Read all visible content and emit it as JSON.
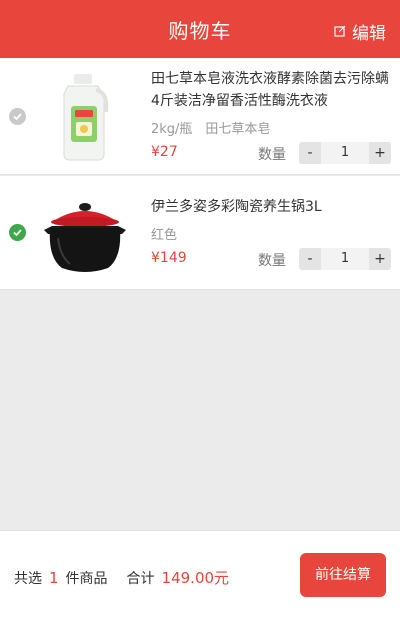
{
  "header": {
    "title": "购物车",
    "edit_label": "编辑"
  },
  "items": [
    {
      "name": "田七草本皂液洗衣液酵素除菌去污除螨4斤装洁净留香活性酶洗衣液",
      "spec": "2kg/瓶　田七草本皂",
      "price": "¥27",
      "qty_label": "数量",
      "qty": "1",
      "selected": false,
      "image": "laundry-detergent-bottle"
    },
    {
      "name": "伊兰多姿多彩陶瓷养生锅3L",
      "spec": "红色",
      "price": "¥149",
      "qty_label": "数量",
      "qty": "1",
      "selected": true,
      "image": "red-ceramic-pot"
    }
  ],
  "stepper": {
    "minus": "-",
    "plus": "+"
  },
  "footer": {
    "selected_prefix": "共选",
    "selected_count": "1",
    "selected_suffix": "件商品",
    "total_label": "合计",
    "total_value": "149.00元",
    "checkout_label": "前往结算"
  },
  "colors": {
    "accent": "#e8453c",
    "check_on": "#3ea84b",
    "check_off": "#c9c9c9"
  },
  "tabbar": {
    "icons": [
      "home-icon",
      "category-icon",
      "cart-icon",
      "profile-icon"
    ]
  }
}
